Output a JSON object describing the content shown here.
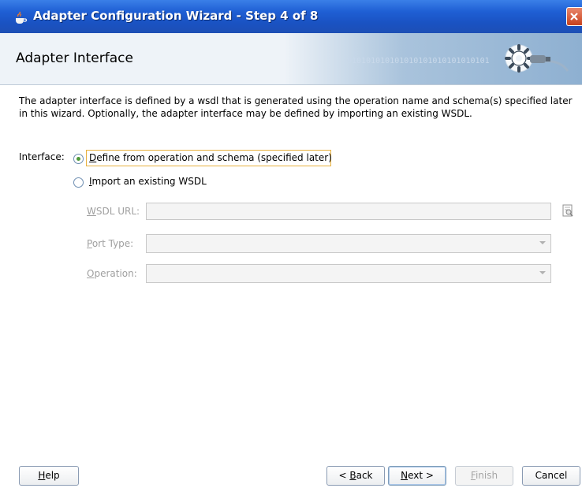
{
  "window": {
    "title": "Adapter Configuration Wizard - Step 4 of 8",
    "close_icon": "close-icon"
  },
  "header": {
    "title": "Adapter Interface",
    "binary_text": "010101010101010101010101010101"
  },
  "description": "The adapter interface is defined by a wsdl that is generated using the operation name and schema(s) specified later in this wizard.  Optionally, the adapter interface may be defined by importing an existing WSDL.",
  "interface": {
    "label": "Interface:",
    "options": [
      {
        "label_mnemonic": "D",
        "label_rest": "efine from operation and schema (specified later)",
        "selected": true
      },
      {
        "label_mnemonic": "I",
        "label_rest": "mport an existing WSDL",
        "selected": false
      }
    ]
  },
  "wsdl": {
    "url_label_mnemonic": "W",
    "url_label_rest": "SDL URL:",
    "url_value": "",
    "port_label_mnemonic": "P",
    "port_label_rest": "ort Type:",
    "port_value": "",
    "operation_label_mnemonic": "O",
    "operation_label_rest": "peration:",
    "operation_value": ""
  },
  "buttons": {
    "help_mn": "H",
    "help_rest": "elp",
    "back_pre": "< ",
    "back_mn": "B",
    "back_rest": "ack",
    "next_mn": "N",
    "next_rest": "ext >",
    "finish_mn": "F",
    "finish_rest": "inish",
    "cancel": "Cancel"
  },
  "colors": {
    "titlebar": "#1f5fd4",
    "header_bg": "#eef3f8",
    "focus_outline": "#e8b13f",
    "radio_dot": "#4f9a3a"
  }
}
